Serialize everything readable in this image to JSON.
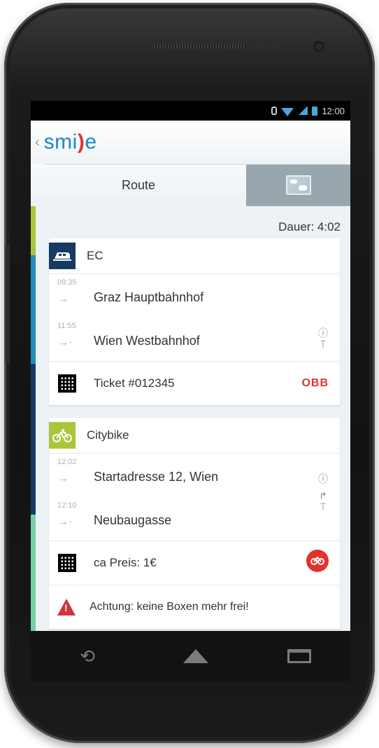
{
  "status": {
    "time": "12:00"
  },
  "app": {
    "back_glyph": "‹",
    "logo_left": "smi",
    "logo_paren": ")",
    "logo_right": "e"
  },
  "tabs": {
    "route_label": "Route"
  },
  "duration": "Dauer: 4:02",
  "train_card": {
    "mode": "EC",
    "stops": [
      {
        "time": "09:35",
        "name": "Graz Hauptbahnhof"
      },
      {
        "time": "11:55",
        "name": "Wien Westbahnhof"
      }
    ],
    "ticket": "Ticket #012345",
    "operator": "OBB"
  },
  "bike_card": {
    "mode": "Citybike",
    "stops": [
      {
        "time": "12:02",
        "name": "Startadresse 12, Wien"
      },
      {
        "time": "12:10",
        "name": "Neubaugasse"
      }
    ],
    "price": "ca Preis: 1€",
    "warning": "Achtung: keine Boxen mehr frei!"
  },
  "icons": {
    "arrow_start": "→",
    "arrow_end": "→·",
    "info": "ⓘ",
    "stop_sign": "⍑",
    "turn": "↱",
    "back_nav": "⟲"
  },
  "colors": {
    "brand_blue": "#1b87c9",
    "brand_red": "#e1332c",
    "leftbar_green": "#a9c63a",
    "leftbar_teal": "#1f8fb7",
    "leftbar_navy": "#173a63",
    "leftbar_mint": "#77cfa5"
  }
}
